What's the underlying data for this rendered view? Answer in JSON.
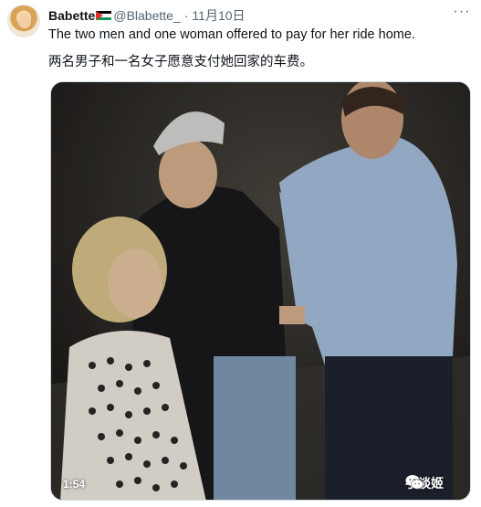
{
  "tweet": {
    "author_name": "Babette",
    "author_handle": "@Blabette_",
    "separator": "·",
    "date": "11月10日",
    "more_label": "···",
    "text_en": "The two men and one woman offered to pay for her ride home.",
    "text_zh": "两名男子和一名女子愿意支付她回家的车费。",
    "flag_icon": "palestine-flag-icon"
  },
  "video": {
    "duration": "1:54",
    "watermark": "手谈姬",
    "watermark_icon": "wechat-icon"
  },
  "colors": {
    "text": "#0f1419",
    "secondary_text": "#536471",
    "media_border": "#cfd9de"
  }
}
